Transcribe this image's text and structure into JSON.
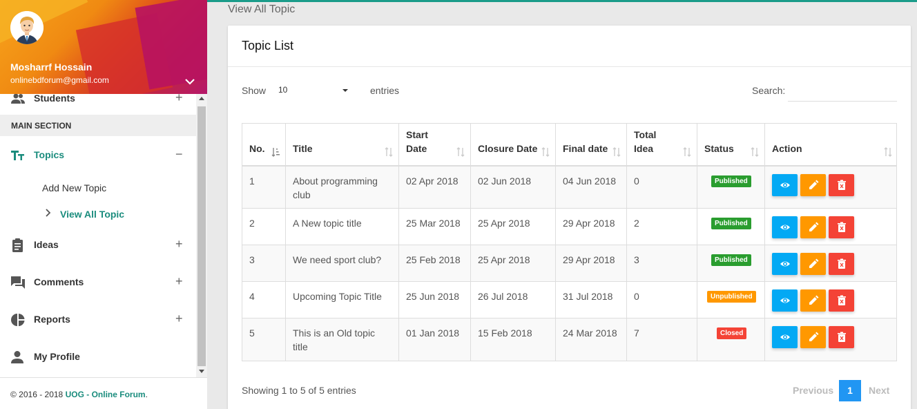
{
  "user": {
    "name": "Mosharrf Hossain",
    "email": "onlinebdforum@gmail.com"
  },
  "sidebar": {
    "partial_item": "Students",
    "section": "MAIN SECTION",
    "topics": {
      "label": "Topics",
      "toggle": "−"
    },
    "sub_items": [
      "Add New Topic",
      "View All Topic"
    ],
    "items": [
      {
        "label": "Ideas",
        "icon": "clipboard-icon"
      },
      {
        "label": "Comments",
        "icon": "comments-icon"
      },
      {
        "label": "Reports",
        "icon": "pie-chart-icon"
      },
      {
        "label": "My Profile",
        "icon": "person-icon"
      }
    ],
    "plus": "+"
  },
  "footer": {
    "prefix": "© 2016 - 2018 ",
    "brand": "UOG - Online Forum",
    "suffix": "."
  },
  "page_title": "View All Topic",
  "card": {
    "title": "Topic List",
    "show_label": "Show",
    "entries_value": "10",
    "entries_label": "entries",
    "search_label": "Search:",
    "search_value": ""
  },
  "table": {
    "headers": [
      "No.",
      "Title",
      "Start Date",
      "Closure Date",
      "Final date",
      "Total Idea",
      "Status",
      "Action"
    ],
    "rows": [
      {
        "no": "1",
        "title": "About programming club",
        "start": "02 Apr 2018",
        "closure": "02 Jun 2018",
        "final": "04 Jun 2018",
        "ideas": "0",
        "status": "Published"
      },
      {
        "no": "2",
        "title": "A New topic title",
        "start": "25 Mar 2018",
        "closure": "25 Apr 2018",
        "final": "29 Apr 2018",
        "ideas": "2",
        "status": "Published"
      },
      {
        "no": "3",
        "title": "We need sport club?",
        "start": "25 Feb 2018",
        "closure": "25 Apr 2018",
        "final": "29 Apr 2018",
        "ideas": "3",
        "status": "Published"
      },
      {
        "no": "4",
        "title": "Upcoming Topic Title",
        "start": "25 Jun 2018",
        "closure": "26 Jul 2018",
        "final": "31 Jul 2018",
        "ideas": "0",
        "status": "Unpublished"
      },
      {
        "no": "5",
        "title": "This is an Old topic title",
        "start": "01 Jan 2018",
        "closure": "15 Feb 2018",
        "final": "24 Mar 2018",
        "ideas": "7",
        "status": "Closed"
      }
    ]
  },
  "status_colors": {
    "Published": "#2a9d2f",
    "Unpublished": "#ff9800",
    "Closed": "#f44336"
  },
  "button_colors": {
    "view": "#03a9f4",
    "edit": "#ff9800",
    "delete": "#f44336"
  },
  "pagination": {
    "info": "Showing 1 to 5 of 5 entries",
    "previous": "Previous",
    "page": "1",
    "next": "Next"
  },
  "colors": {
    "accent": "#1a8c7d",
    "topbar": "#1a9c8a"
  }
}
